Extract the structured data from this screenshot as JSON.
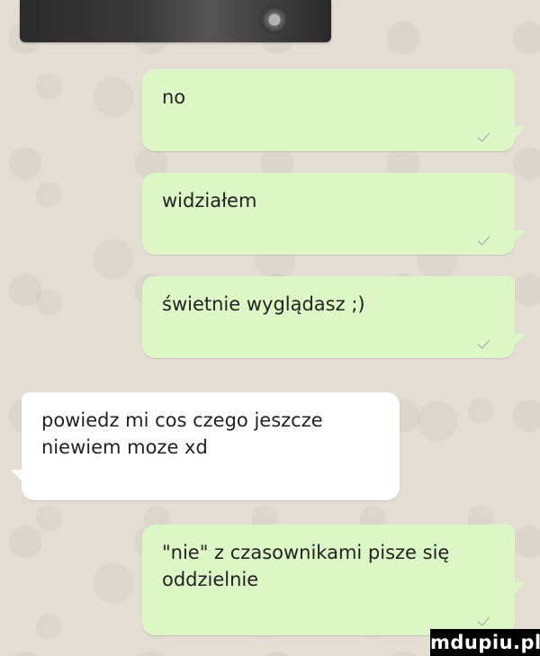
{
  "messages": [
    {
      "direction": "outgoing",
      "text": "no",
      "status": "sent-check"
    },
    {
      "direction": "outgoing",
      "text": "widziałem",
      "status": "sent-check"
    },
    {
      "direction": "outgoing",
      "text": "świetnie wyglądasz ;)",
      "status": "sent-check"
    },
    {
      "direction": "incoming",
      "text": "powiedz mi cos czego jeszcze\nniewiem moze xd"
    },
    {
      "direction": "outgoing",
      "text": "\"nie\" z czasownikami pisze się\noddzielnie",
      "status": "sent-check"
    }
  ],
  "watermark": "mdupiu.pl",
  "colors": {
    "outgoing_bubble": "#dcf6c6",
    "incoming_bubble": "#ffffff",
    "background": "#e4ddd4"
  }
}
